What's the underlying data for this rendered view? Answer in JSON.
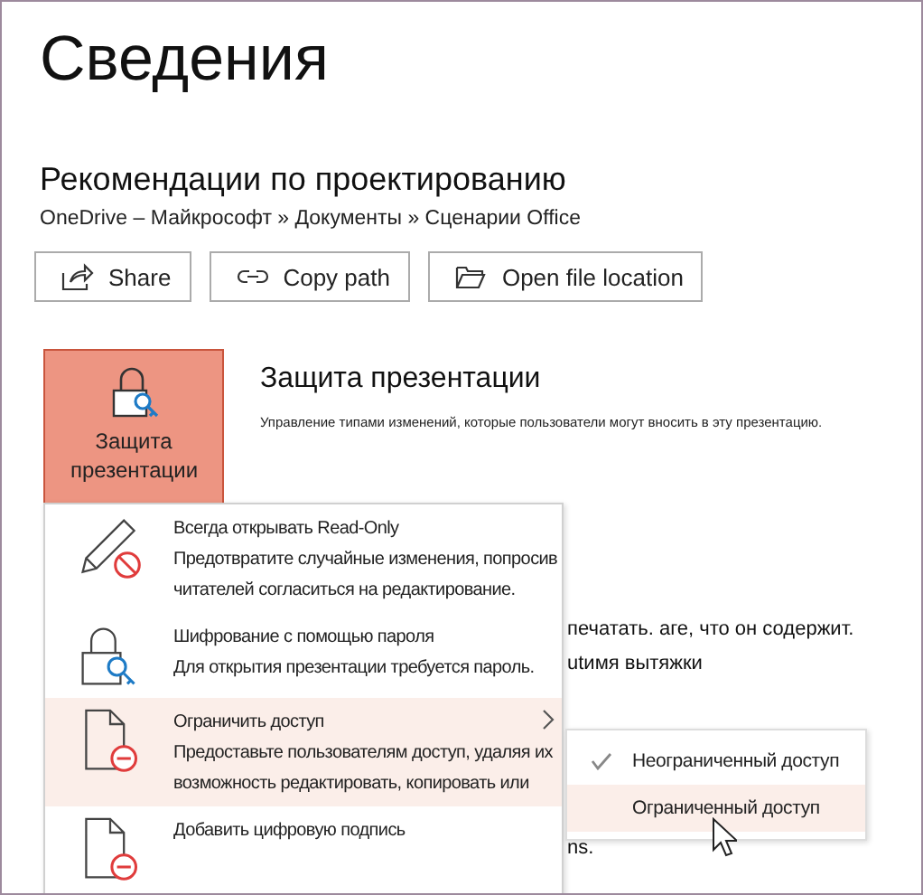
{
  "page_title": "Сведения",
  "document": {
    "title": "Рекомендации по проектированию",
    "path": "OneDrive – Майкрософт » Документы » Сценарии Office"
  },
  "buttons": [
    {
      "label": "Share"
    },
    {
      "label": "Copy path"
    },
    {
      "label": "Open file location"
    }
  ],
  "protect": {
    "tile_label": "Защита презентации",
    "heading": "Защита презентации",
    "description": "Управление типами изменений, которые пользователи могут вносить в эту презентацию."
  },
  "background_text": [
    "печатать. аге, что он содержит.",
    "utимя вытяжки",
    "ns."
  ],
  "menu": [
    {
      "title": "Всегда открывать Read-Only",
      "description": "Предотвратите случайные изменения, попросив читателей согласиться на редактирование.",
      "highlighted": false,
      "submenu": false
    },
    {
      "title": "Шифрование с помощью пароля",
      "description": "Для открытия презентации требуется пароль.",
      "highlighted": false,
      "submenu": false
    },
    {
      "title": "Ограничить доступ",
      "description": "Предоставьте пользователям доступ, удаляя их возможность редактировать, копировать или",
      "highlighted": true,
      "submenu": true
    },
    {
      "title": "Добавить цифровую подпись",
      "highlighted": false,
      "submenu": false
    }
  ],
  "submenu": [
    {
      "label": "Неограниченный доступ",
      "checked": true,
      "highlighted": false
    },
    {
      "label": "Ограниченный доступ",
      "checked": false,
      "highlighted": true
    }
  ]
}
